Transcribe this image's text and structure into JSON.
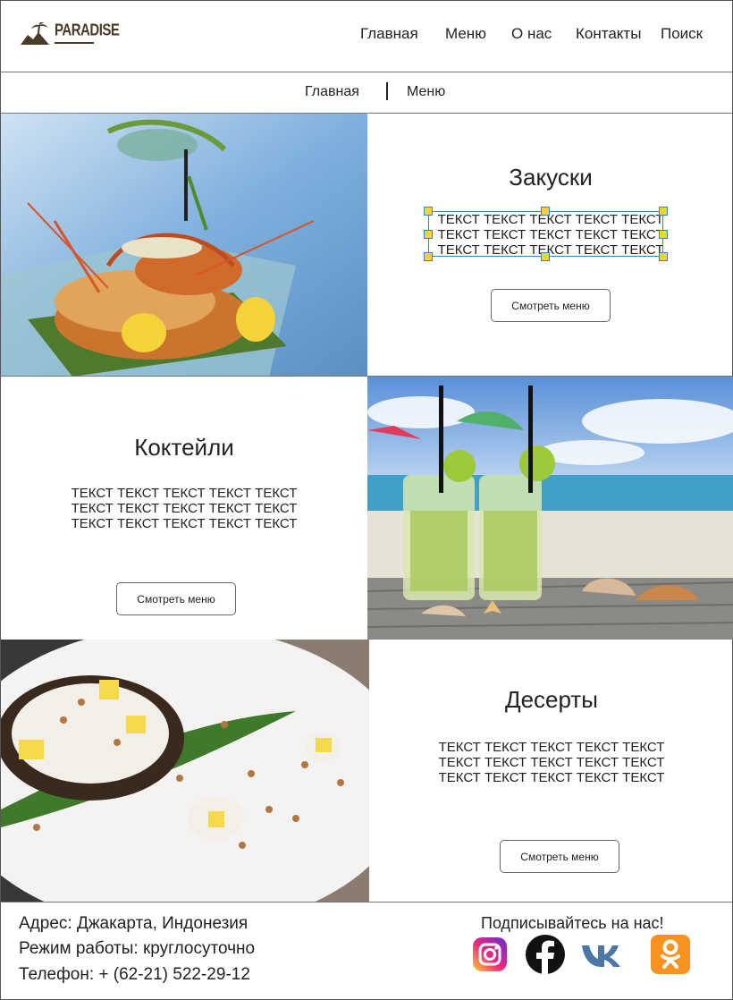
{
  "header": {
    "logo_text": "PARADISE",
    "nav": [
      {
        "label": "Главная"
      },
      {
        "label": "Меню"
      },
      {
        "label": "О нас"
      },
      {
        "label": "Контакты"
      },
      {
        "label": "Поиск"
      }
    ]
  },
  "breadcrumb": {
    "items": [
      "Главная",
      "Меню"
    ]
  },
  "sections": [
    {
      "title": "Закуски",
      "text_lines": [
        "ТЕКСТ ТЕКСТ ТЕКСТ ТЕКСТ ТЕКСТ",
        "ТЕКСТ ТЕКСТ ТЕКСТ ТЕКСТ ТЕКСТ",
        "ТЕКСТ ТЕКСТ ТЕКСТ ТЕКСТ ТЕКСТ"
      ],
      "button": "Смотреть меню",
      "image": "seafood-lobster-photo"
    },
    {
      "title": "Коктейли",
      "text_lines": [
        "ТЕКСТ ТЕКСТ ТЕКСТ ТЕКСТ ТЕКСТ",
        "ТЕКСТ ТЕКСТ ТЕКСТ ТЕКСТ ТЕКСТ",
        "ТЕКСТ ТЕКСТ ТЕКСТ ТЕКСТ ТЕКСТ"
      ],
      "button": "Смотреть меню",
      "image": "beach-cocktails-photo"
    },
    {
      "title": "Десерты",
      "text_lines": [
        "ТЕКСТ ТЕКСТ ТЕКСТ ТЕКСТ ТЕКСТ",
        "ТЕКСТ ТЕКСТ ТЕКСТ ТЕКСТ ТЕКСТ",
        "ТЕКСТ ТЕКСТ ТЕКСТ ТЕКСТ ТЕКСТ"
      ],
      "button": "Смотреть меню",
      "image": "coconut-dessert-photo"
    }
  ],
  "footer": {
    "address": "Адрес: Джакарта, Индонезия",
    "hours": "Режим работы: круглосуточно",
    "phone": "Телефон: + (62-21) 522-29-12",
    "follow_label": "Подписывайтесь на нас!",
    "social_icons": [
      "instagram-icon",
      "facebook-icon",
      "vk-icon",
      "odnoklassniki-icon"
    ]
  },
  "colors": {
    "selection_border": "#3b82c4",
    "selection_handle": "#f2d43a",
    "instagram": "#c13584",
    "facebook": "#111111",
    "vk": "#4a76a8",
    "odnoklassniki": "#f7931e"
  }
}
